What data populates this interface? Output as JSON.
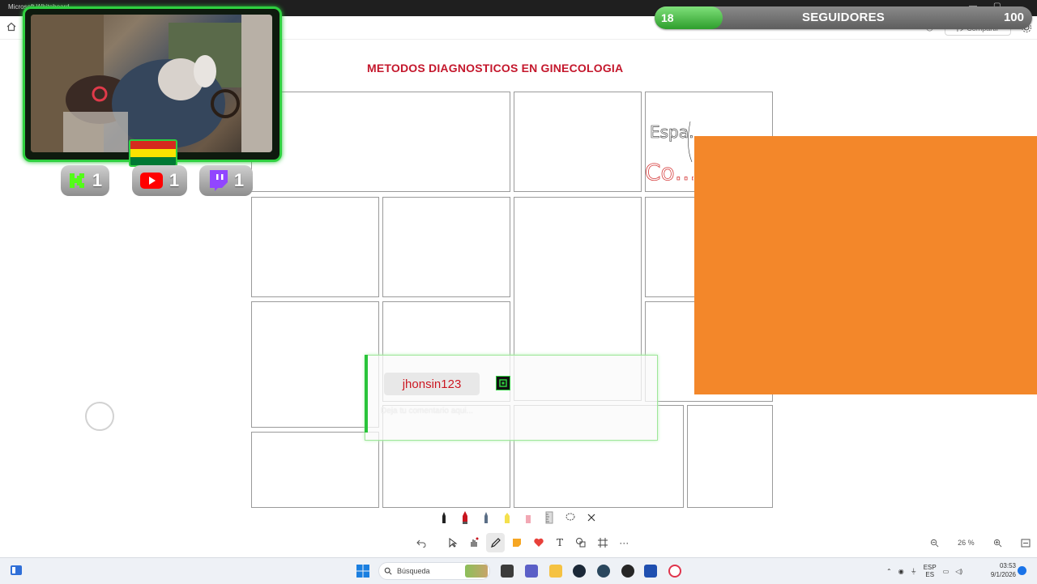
{
  "window": {
    "app_title": "Microsoft Whiteboard"
  },
  "topbar": {
    "share_label": "Compartir"
  },
  "followers": {
    "current": 18,
    "goal": 100,
    "progress_fraction": 0.18,
    "label": "SEGUIDORES",
    "current_text": "18",
    "goal_text": "100"
  },
  "board": {
    "title": "METODOS DIAGNOSTICOS EN GINECOLOGIA",
    "handwriting_lines": [
      "Espa…",
      "Co…"
    ]
  },
  "overlay": {
    "kick_count": "1",
    "youtube_count": "1",
    "twitch_count": "1"
  },
  "chat": {
    "username": "jhonsin123",
    "message": "Deja tu comentario aqui..."
  },
  "colors": {
    "accent_green": "#2fd040",
    "follower_fill": "#3cb43a",
    "title_red": "#c4172c",
    "orange_block": "#f3872a",
    "youtube_red": "#ff0000",
    "twitch_purple": "#9146ff",
    "kick_green": "#53fc18"
  },
  "toolbar": {
    "pens": [
      "black-pen-icon",
      "red-pen-icon",
      "blue-pen-icon",
      "yellow-highlighter-icon",
      "pink-highlighter-icon",
      "ruler-icon",
      "lasso-icon",
      "close-icon"
    ],
    "tools": [
      "undo-icon",
      "select-icon",
      "hand-icon",
      "pen-tool-icon",
      "sticky-note-icon",
      "reaction-heart-icon",
      "text-icon",
      "shapes-icon",
      "frame-icon",
      "more-icon"
    ],
    "text_tool_label": "T",
    "more_label": "···"
  },
  "zoom": {
    "level": "26 %"
  },
  "taskbar": {
    "search_placeholder": "Búsqueda",
    "language": "ESP",
    "language_sub": "ES",
    "time": "03:53",
    "date": "9/1/2026"
  }
}
